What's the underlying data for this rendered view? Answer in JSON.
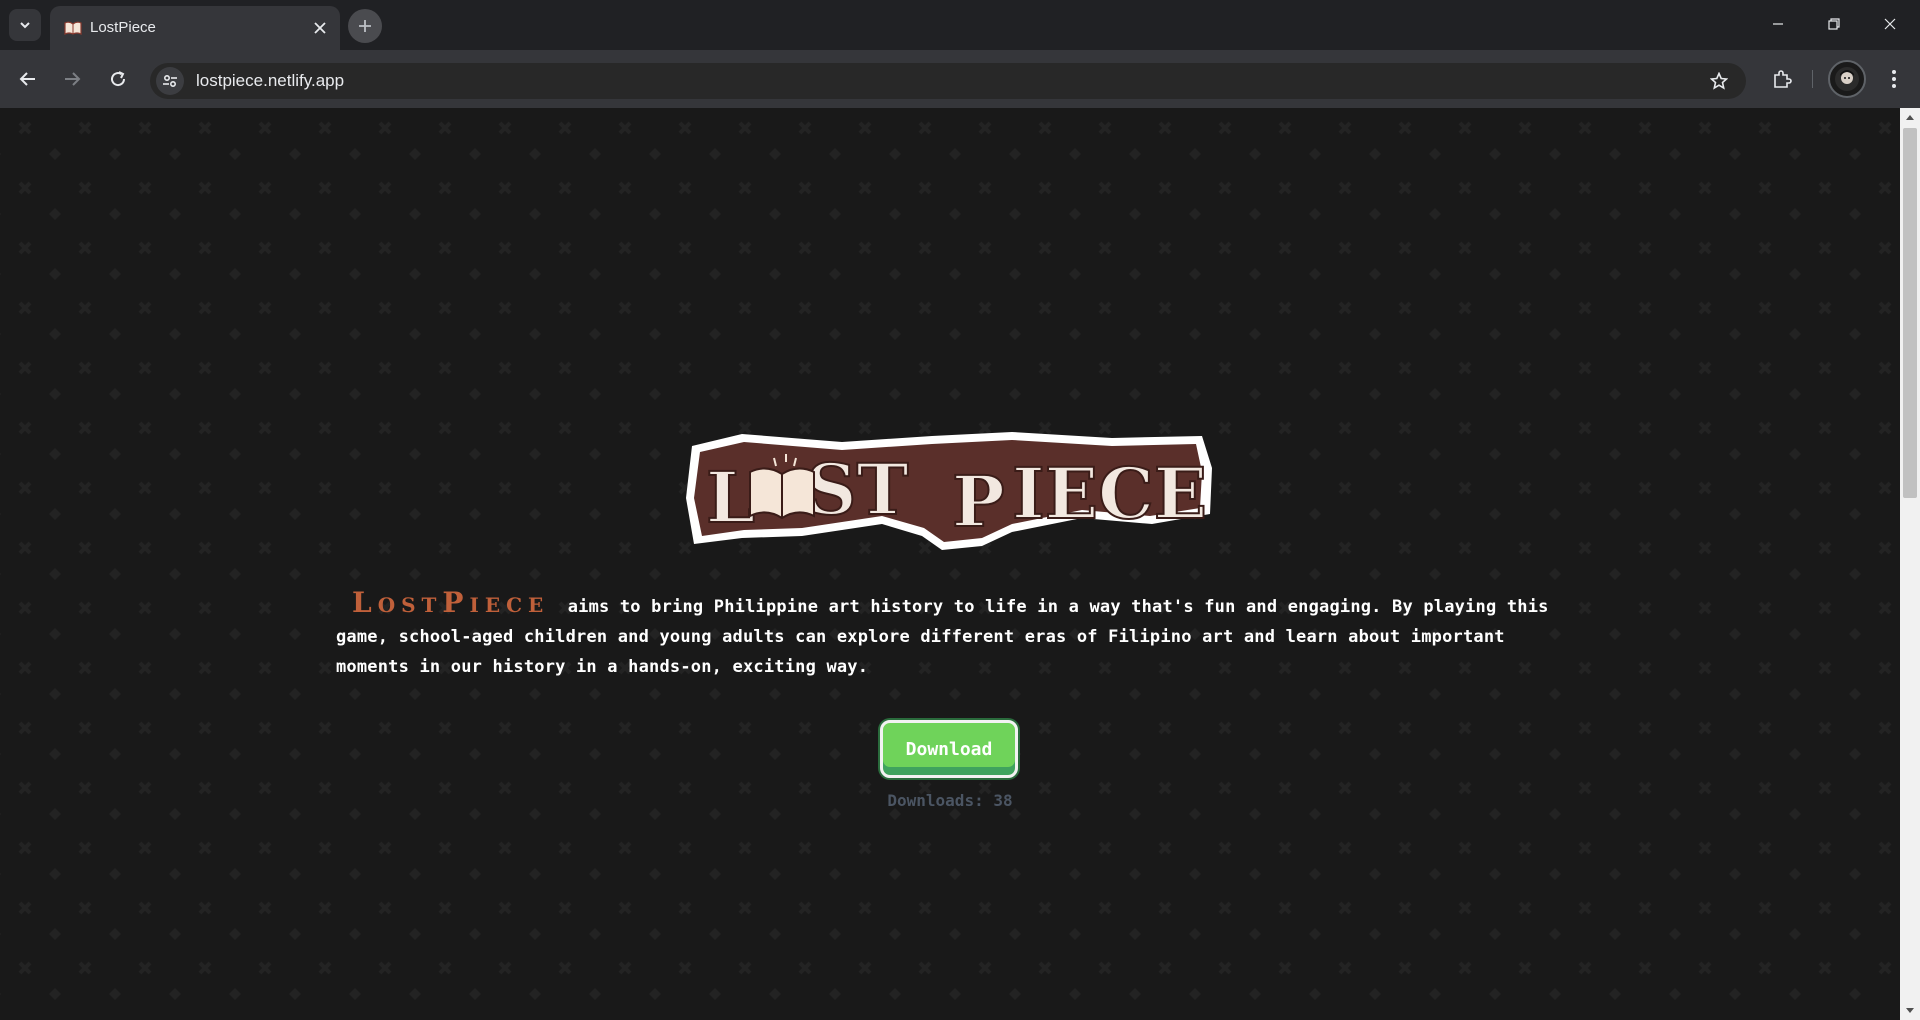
{
  "browser": {
    "tab_title": "LostPiece",
    "url": "lostpiece.netlify.app"
  },
  "page": {
    "logo_text": "LOST PIECE",
    "brand_word": "LostPiece",
    "intro_text": "aims to bring Philippine art history to life in a way that's fun and engaging. By playing this game, school-aged children and young adults can explore different eras of Filipino art and learn about important moments in our history in a hands-on, exciting way.",
    "download_label": "Download",
    "downloads_count": "Downloads: 38"
  },
  "colors": {
    "background": "#191919",
    "brand_accent": "#c0603a",
    "button_green": "#6fd35a",
    "logo_brown": "#5a2f2a"
  },
  "icons": [
    "tab-search-icon",
    "book-favicon",
    "close-icon",
    "plus-icon",
    "minimize-icon",
    "restore-icon",
    "window-close-icon",
    "back-arrow-icon",
    "forward-arrow-icon",
    "reload-icon",
    "site-info-icon",
    "star-icon",
    "extensions-icon",
    "profile-avatar",
    "more-vert-icon"
  ]
}
